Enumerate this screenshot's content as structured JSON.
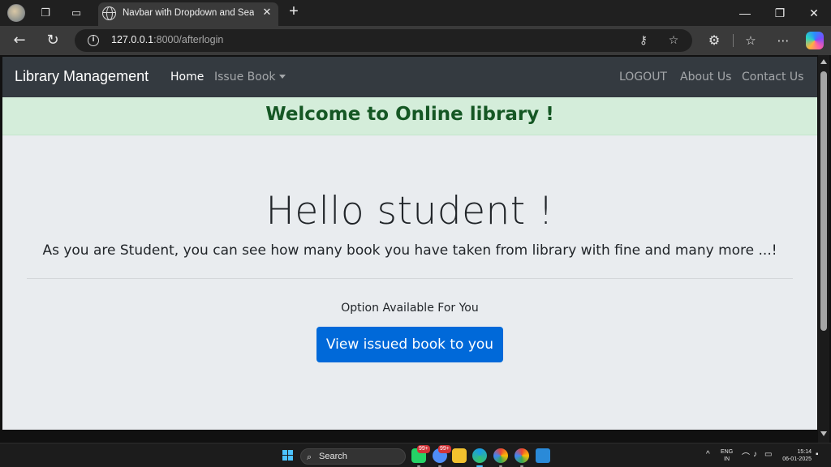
{
  "browser": {
    "tab_title": "Navbar with Dropdown and Search",
    "url_host": "127.0.0.1",
    "url_rest": ":8000/afterlogin"
  },
  "navbar": {
    "brand": "Library Management",
    "home": "Home",
    "issue_book": "Issue Book",
    "logout": "LOGOUT",
    "about": "About Us",
    "contact": "Contact Us"
  },
  "alert": {
    "message": "Welcome to Online library !"
  },
  "jumbotron": {
    "heading": "Hello student !",
    "lead": "As you are Student, you can see how many book you have taken from library with fine and many more ...!",
    "options_label": "Option Available For You",
    "button_label": "View issued book to you"
  },
  "taskbar": {
    "search_label": "Search",
    "badge_1": "99+",
    "badge_2": "99+",
    "lang_line1": "ENG",
    "lang_line2": "IN",
    "time": "15:14",
    "date": "06-01-2025"
  },
  "colors": {
    "navbar_bg": "#343a40",
    "alert_bg": "#d4edda",
    "alert_text": "#155724",
    "primary_button": "#0069d9",
    "page_bg": "#e9ecef"
  }
}
